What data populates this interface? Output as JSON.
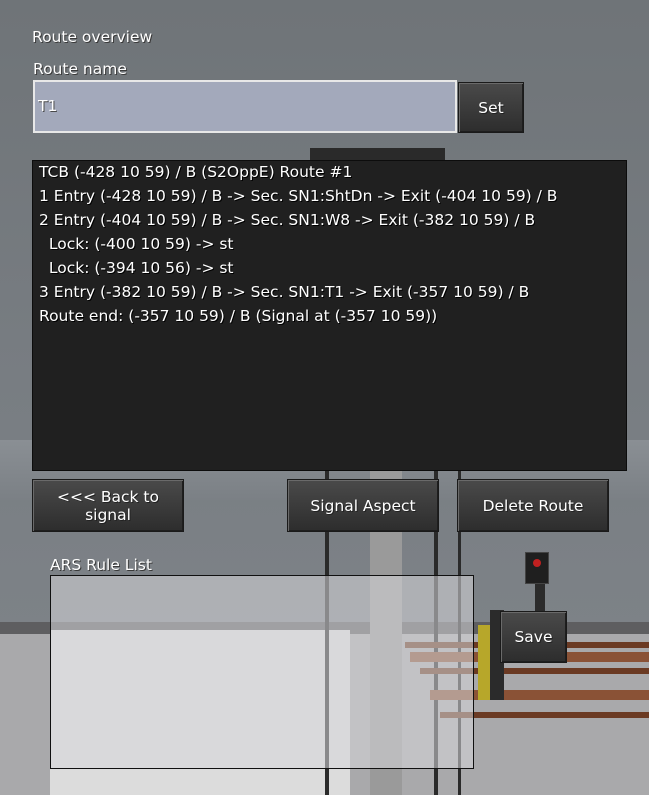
{
  "window": {
    "title": "Route overview"
  },
  "route_name": {
    "label": "Route name",
    "value": "T1",
    "set_button": "Set"
  },
  "route_details": {
    "lines": [
      "TCB (-428 10 59) / B (S2OppE) Route #1",
      "1 Entry (-428 10 59) / B -> Sec. SN1:ShtDn -> Exit (-404 10 59) / B",
      "2 Entry (-404 10 59) / B -> Sec. SN1:W8 -> Exit (-382 10 59) / B",
      "  Lock: (-400 10 59) -> st",
      "  Lock: (-394 10 56) -> st",
      "3 Entry (-382 10 59) / B -> Sec. SN1:T1 -> Exit (-357 10 59) / B",
      "Route end: (-357 10 59) / B (Signal at (-357 10 59))"
    ]
  },
  "actions": {
    "back": "<<< Back to signal",
    "signal_aspect": "Signal Aspect",
    "delete_route": "Delete Route"
  },
  "ars": {
    "label": "ARS Rule List",
    "value": "",
    "save_button": "Save"
  },
  "colors": {
    "panel_background": "#202020",
    "textfield_background": "#a3a9bb",
    "button_background": "#3a3a3a",
    "text": "#ffffff"
  }
}
